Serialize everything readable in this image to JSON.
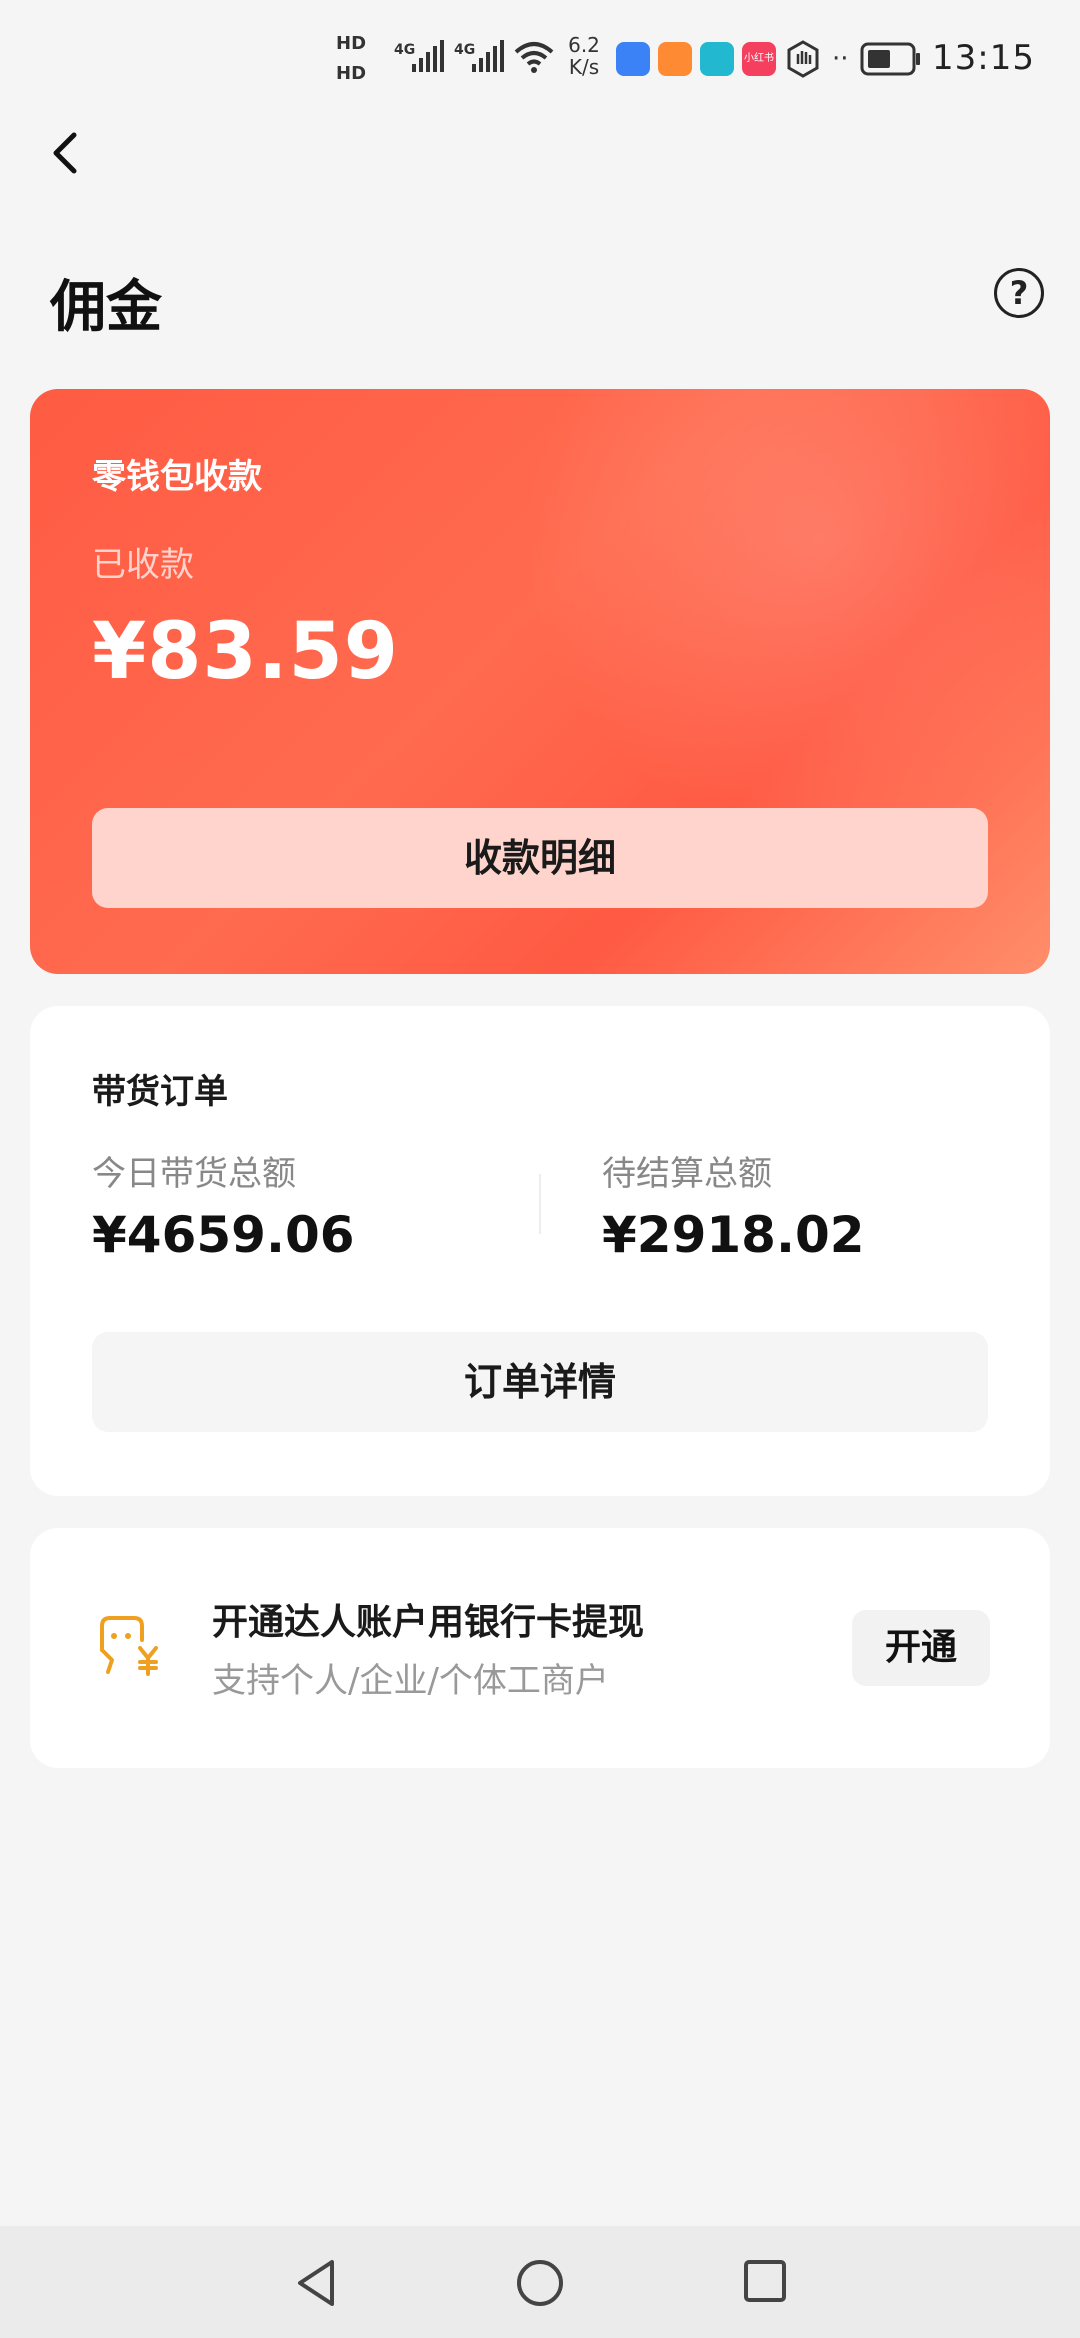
{
  "status_bar": {
    "hd1": "HD",
    "hd2": "HD",
    "net1": "4G",
    "net2": "4G",
    "speed_value": "6.2",
    "speed_unit": "K/s",
    "time": "13:15",
    "app_icon_colors": [
      "#3b82f6",
      "#ff8a34",
      "#22b8cf",
      "#f43f5e"
    ],
    "app_icon_3_label": "小红书"
  },
  "header": {
    "title": "佣金",
    "help_icon": "?"
  },
  "wallet": {
    "title": "零钱包收款",
    "subtitle": "已收款",
    "amount": "¥83.59",
    "button_label": "收款明细",
    "gradient_colors": [
      "#ff5b43",
      "#ff8e6a"
    ]
  },
  "orders": {
    "title": "带货订单",
    "today_label": "今日带货总额",
    "today_value": "¥4659.06",
    "pending_label": "待结算总额",
    "pending_value": "¥2918.02",
    "button_label": "订单详情"
  },
  "open_account": {
    "title": "开通达人账户用银行卡提现",
    "subtitle": "支持个人/企业/个体工商户",
    "button_label": "开通",
    "icon": "wallet-yuan-icon",
    "icon_color": "#f0a020"
  },
  "nav_bar": {
    "icons": [
      "back-triangle-icon",
      "home-circle-icon",
      "recents-square-icon"
    ]
  }
}
